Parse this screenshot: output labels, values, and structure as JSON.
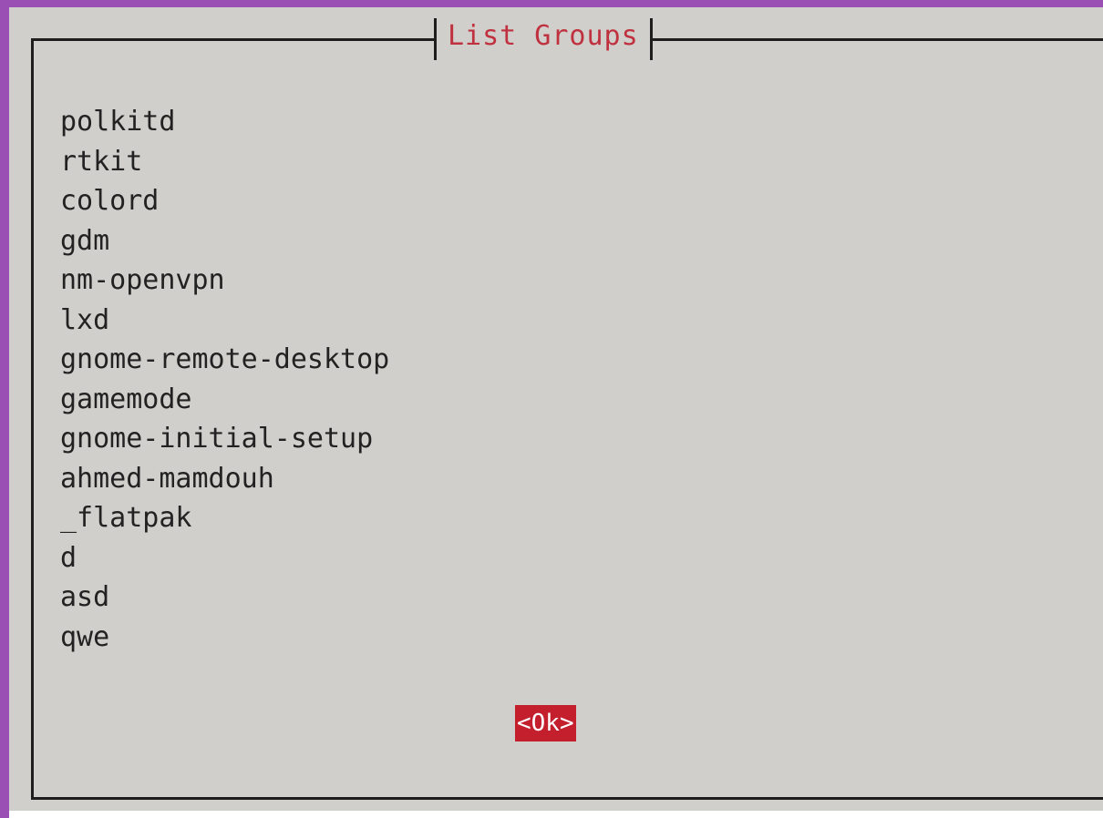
{
  "dialog": {
    "title": "List Groups",
    "groups": [
      "polkitd",
      "rtkit",
      "colord",
      "gdm",
      "nm-openvpn",
      "lxd",
      "gnome-remote-desktop",
      "gamemode",
      "gnome-initial-setup",
      "ahmed-mamdouh",
      "_flatpak",
      "d",
      "asd",
      "qwe"
    ],
    "ok_label": "<Ok>"
  },
  "colors": {
    "background": "#d0cfcb",
    "title_text": "#c0313f",
    "button_bg": "#c41f2c",
    "button_text": "#ffffff",
    "window_border": "#9a4fb5"
  }
}
